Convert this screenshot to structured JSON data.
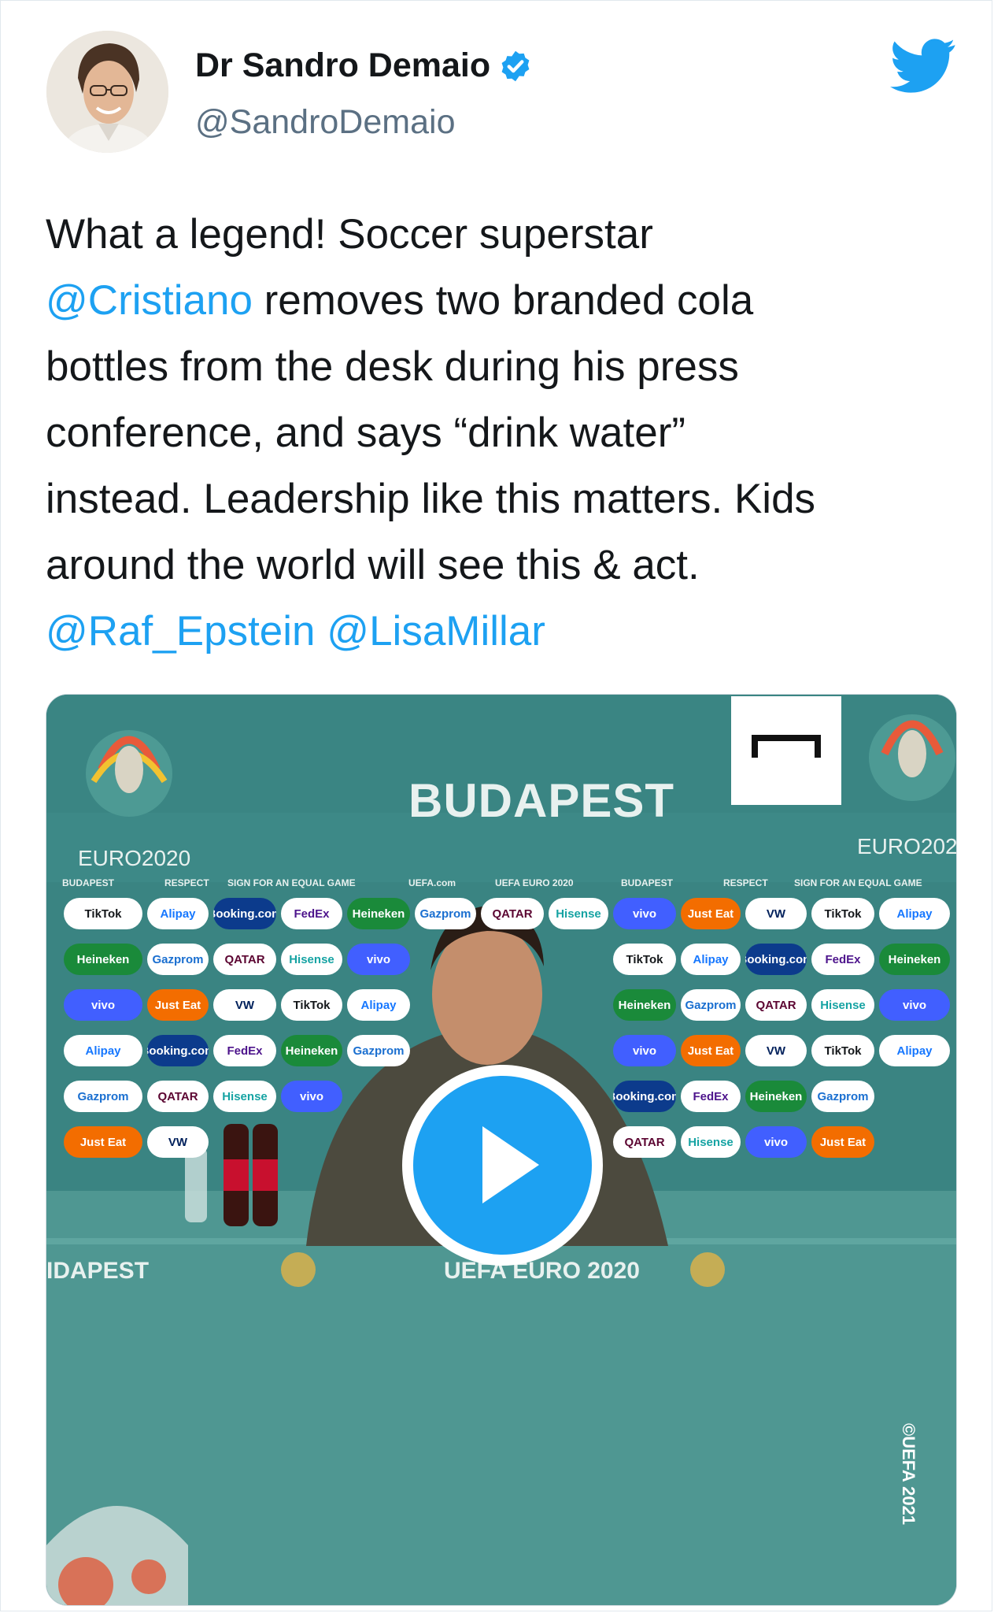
{
  "author": {
    "name": "Dr Sandro Demaio",
    "handle": "@SandroDemaio",
    "verified": true
  },
  "tweet": {
    "line1": "What a legend! Soccer superstar",
    "mention_cristiano": "@Cristiano",
    "line2_rest": " removes two branded cola",
    "line3": "bottles from the desk during his press",
    "line4": "conference, and says “drink water”",
    "line5": "instead. Leadership like this matters. Kids",
    "line6": "around the world will see this & act.",
    "mention_raf": "@Raf_Epstein",
    "mention_lisa": "@LisaMillar"
  },
  "video": {
    "city": "BUDAPEST",
    "euro_left": "EURO2020",
    "euro_right": "EURO202",
    "desk_left": "IDAPEST",
    "desk_center": "UEFA EURO 2020",
    "copyright": "©UEFA 2021",
    "strip": [
      "BUDAPEST",
      "RESPECT",
      "SIGN FOR AN EQUAL GAME",
      "UEFA.com",
      "UEFA EURO 2020",
      "BUDAPEST",
      "RESPECT",
      "SIGN FOR AN EQUAL GAME"
    ],
    "sponsors": [
      "TikTok",
      "Alipay",
      "Booking.com",
      "FedEx",
      "Heineken",
      "Gazprom",
      "QATAR",
      "Hisense",
      "vivo",
      "Just Eat",
      "VW"
    ]
  },
  "colors": {
    "link": "#1da1f2",
    "backdrop": "#3f8c8a",
    "play": "#1da1f2",
    "handle": "#5b7083"
  },
  "icons": [
    "verified-badge-icon",
    "twitter-bird-icon",
    "play-icon",
    "goal-logo-icon"
  ]
}
